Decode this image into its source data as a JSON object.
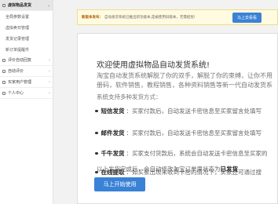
{
  "sidebar": {
    "items": [
      {
        "label": "虚拟物品发货",
        "type": "section",
        "active": true
      },
      {
        "label": "全局参数设置",
        "type": "sub"
      },
      {
        "label": "虚拟卖日管理",
        "type": "sub"
      },
      {
        "label": "发货记录管理",
        "type": "sub"
      },
      {
        "label": "新订单提醒件",
        "type": "sub"
      },
      {
        "label": "评价自动回复",
        "type": "section"
      },
      {
        "label": "自动评价",
        "type": "section"
      },
      {
        "label": "买家用户管理",
        "type": "section"
      },
      {
        "label": "个人中心",
        "type": "section"
      }
    ]
  },
  "notice": {
    "label": "新版本发布：",
    "text": "自动发货系统已推出新功能本,是被使用旧版本，无需担忧!",
    "button": "马上去看看"
  },
  "welcome": {
    "title": "欢迎使用虚拟物品自动发货系统!",
    "intro_line1": "淘宝自动发货系统解脱了你的双手，解脱了你的束缚，让你不用",
    "intro_line2": "册码，软件销售，教程销售，各种资料销售等新一代自动发货系",
    "types_intro": "系统支持多种发货方式：",
    "features": [
      {
        "name": "短信发货",
        "desc": "：买家付款后，自动发送卡密信息至买家留言处填写"
      },
      {
        "name": "邮件发货",
        "desc": "：买家付款后，自动发送卡密信息至买家留言处填写"
      },
      {
        "name": "千牛发货",
        "desc": "：买家支付货款后，系统会自动发送卡密信息至买家的"
      },
      {
        "name": "在线提取",
        "desc": "：如买家出现未收到卡密的情况下，买家还可通过搜"
      }
    ],
    "footer_text": "以上发货完成后，会自动修改淘宝订单里状态为",
    "footer_status": "已发货",
    "start_button": "马上开始使用"
  }
}
